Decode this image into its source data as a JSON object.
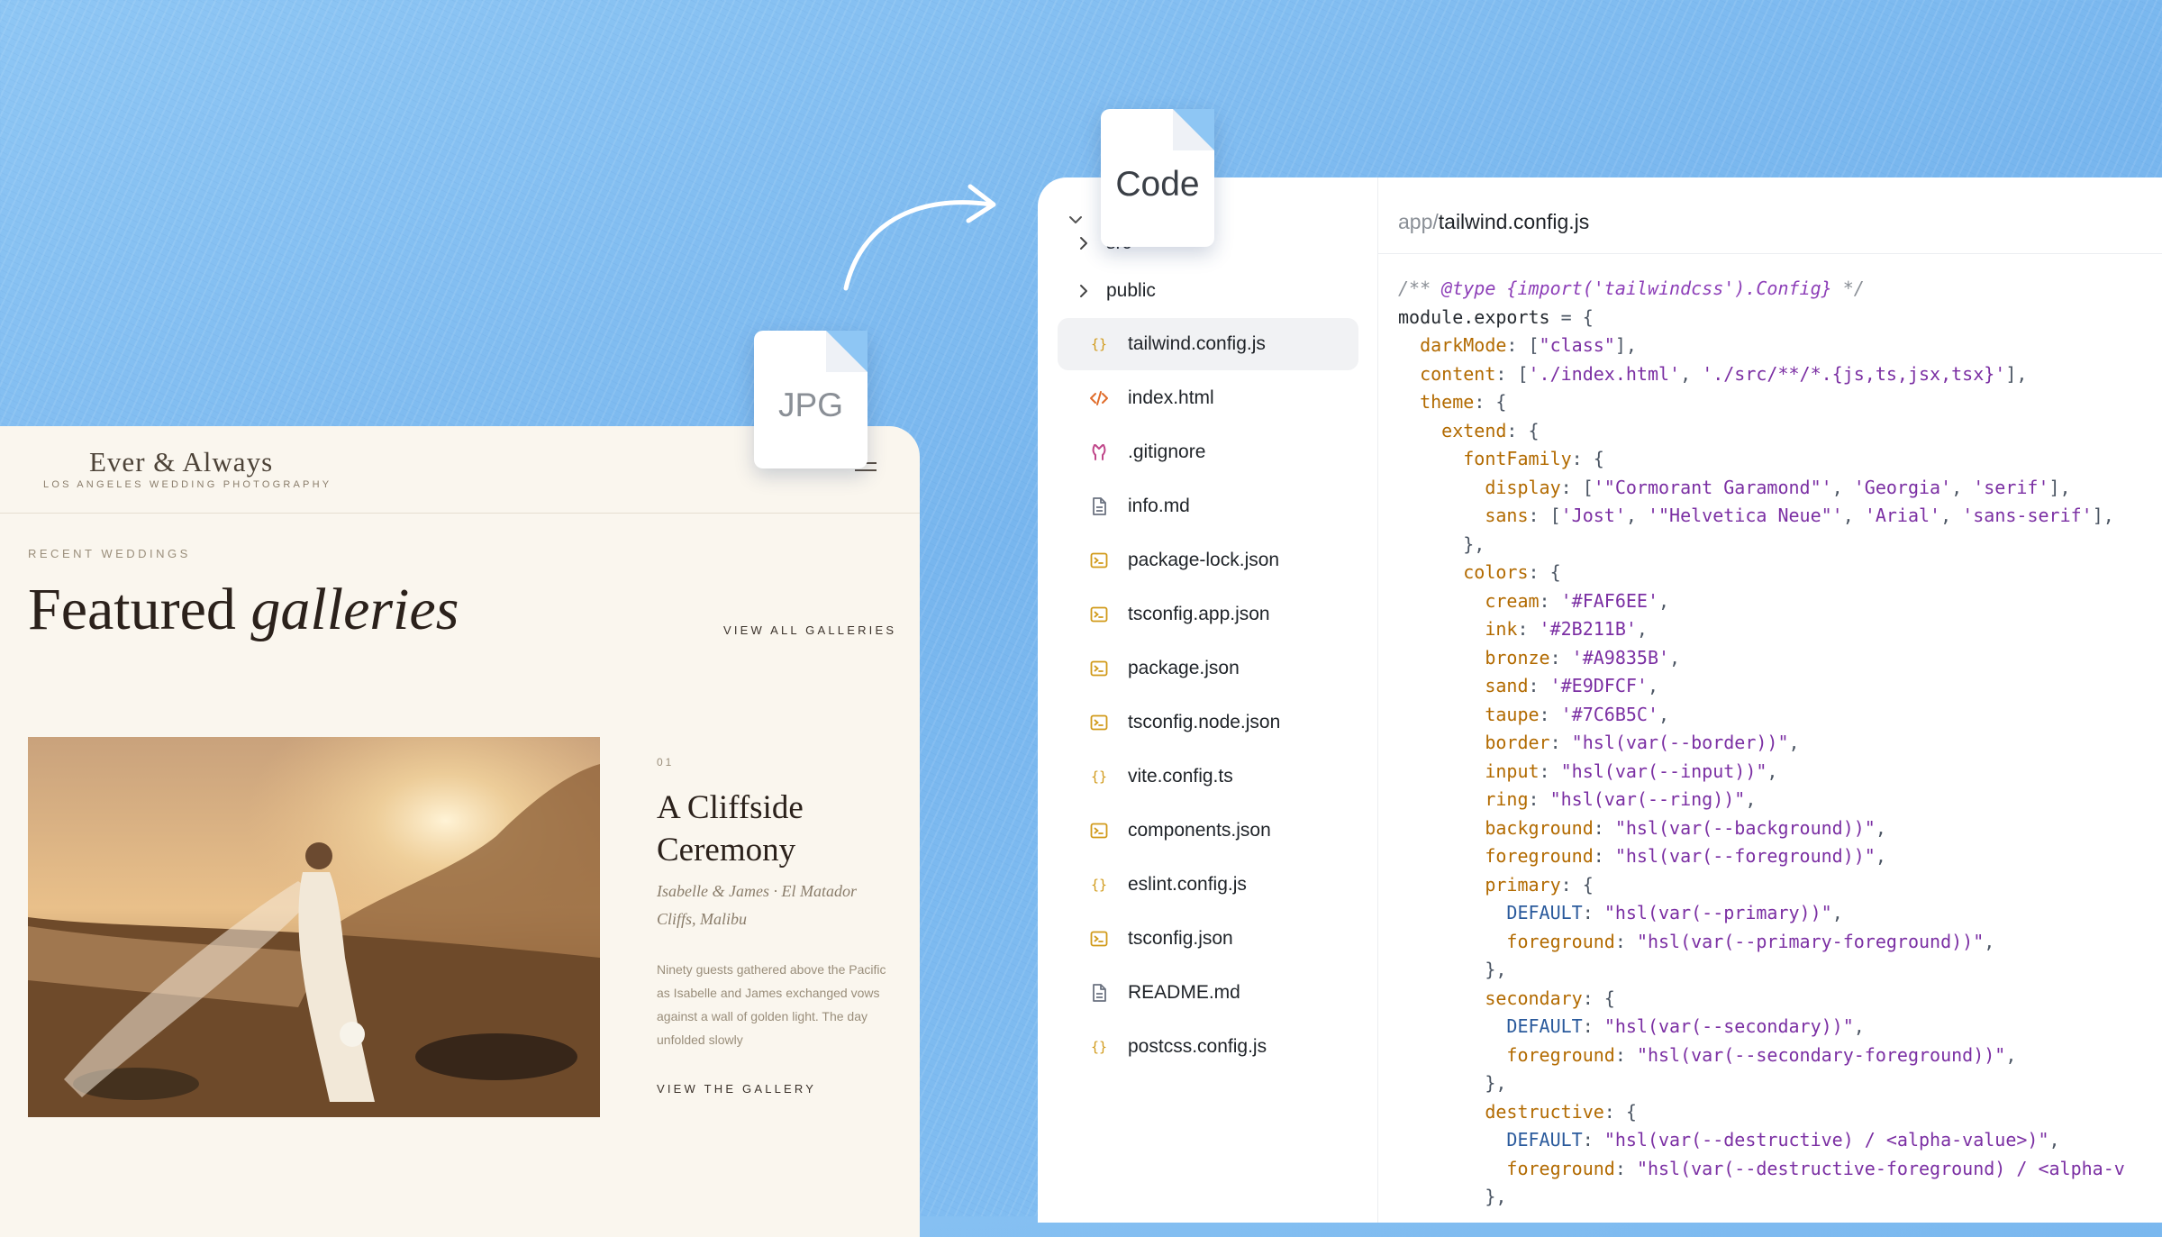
{
  "site": {
    "brand_name": "Ever & Always",
    "brand_tagline": "LOS ANGELES WEDDING PHOTOGRAPHY",
    "section_label": "RECENT WEDDINGS",
    "title_plain": "Featured ",
    "title_italic": "galleries",
    "view_all": "VIEW ALL GALLERIES",
    "feature": {
      "number": "01",
      "title": "A Cliffside Ceremony",
      "subtitle": "Isabelle & James · El Matador Cliffs, Malibu",
      "body": "Ninety guests gathered above the Pacific as Isabelle and James exchanged vows against a wall of golden light. The day unfolded slowly",
      "cta": "VIEW THE GALLERY"
    }
  },
  "badges": {
    "jpg": "JPG",
    "code": "Code"
  },
  "file_tree": {
    "items": [
      {
        "name": "src",
        "type": "folder",
        "icon": "chevron-right-icon"
      },
      {
        "name": "public",
        "type": "folder",
        "icon": "chevron-right-icon"
      },
      {
        "name": "tailwind.config.js",
        "type": "file",
        "icon": "braces-icon",
        "active": true
      },
      {
        "name": "index.html",
        "type": "file",
        "icon": "code-tag-icon"
      },
      {
        "name": ".gitignore",
        "type": "file",
        "icon": "git-icon"
      },
      {
        "name": "info.md",
        "type": "file",
        "icon": "document-icon"
      },
      {
        "name": "package-lock.json",
        "type": "file",
        "icon": "terminal-icon"
      },
      {
        "name": "tsconfig.app.json",
        "type": "file",
        "icon": "terminal-icon"
      },
      {
        "name": "package.json",
        "type": "file",
        "icon": "terminal-icon"
      },
      {
        "name": "tsconfig.node.json",
        "type": "file",
        "icon": "terminal-icon"
      },
      {
        "name": "vite.config.ts",
        "type": "file",
        "icon": "braces-icon"
      },
      {
        "name": "components.json",
        "type": "file",
        "icon": "terminal-icon"
      },
      {
        "name": "eslint.config.js",
        "type": "file",
        "icon": "braces-icon"
      },
      {
        "name": "tsconfig.json",
        "type": "file",
        "icon": "terminal-icon"
      },
      {
        "name": "README.md",
        "type": "file",
        "icon": "document-icon"
      },
      {
        "name": "postcss.config.js",
        "type": "file",
        "icon": "braces-icon"
      }
    ]
  },
  "editor": {
    "breadcrumb_dir": "app",
    "breadcrumb_sep": "/",
    "breadcrumb_file": "tailwind.config.js",
    "code_lines": [
      [
        [
          "c-com",
          "/** "
        ],
        [
          "c-doc",
          "@type {import('tailwindcss').Config}"
        ],
        [
          "c-com",
          " */"
        ]
      ],
      [
        [
          "",
          "module.exports "
        ],
        [
          "c-pun",
          "= {"
        ]
      ],
      [
        [
          "",
          "  "
        ],
        [
          "c-key",
          "darkMode"
        ],
        [
          "c-pun",
          ": ["
        ],
        [
          "c-str",
          "\"class\""
        ],
        [
          "c-pun",
          "],"
        ]
      ],
      [
        [
          "",
          "  "
        ],
        [
          "c-key",
          "content"
        ],
        [
          "c-pun",
          ": ["
        ],
        [
          "c-str",
          "'./index.html'"
        ],
        [
          "c-pun",
          ", "
        ],
        [
          "c-str",
          "'./src/**/*.{js,ts,jsx,tsx}'"
        ],
        [
          "c-pun",
          "],"
        ]
      ],
      [
        [
          "",
          "  "
        ],
        [
          "c-key",
          "theme"
        ],
        [
          "c-pun",
          ": {"
        ]
      ],
      [
        [
          "",
          "    "
        ],
        [
          "c-key",
          "extend"
        ],
        [
          "c-pun",
          ": {"
        ]
      ],
      [
        [
          "",
          "      "
        ],
        [
          "c-key",
          "fontFamily"
        ],
        [
          "c-pun",
          ": {"
        ]
      ],
      [
        [
          "",
          "        "
        ],
        [
          "c-key",
          "display"
        ],
        [
          "c-pun",
          ": ["
        ],
        [
          "c-str",
          "'\"Cormorant Garamond\"'"
        ],
        [
          "c-pun",
          ", "
        ],
        [
          "c-str",
          "'Georgia'"
        ],
        [
          "c-pun",
          ", "
        ],
        [
          "c-str",
          "'serif'"
        ],
        [
          "c-pun",
          "],"
        ]
      ],
      [
        [
          "",
          "        "
        ],
        [
          "c-key",
          "sans"
        ],
        [
          "c-pun",
          ": ["
        ],
        [
          "c-str",
          "'Jost'"
        ],
        [
          "c-pun",
          ", "
        ],
        [
          "c-str",
          "'\"Helvetica Neue\"'"
        ],
        [
          "c-pun",
          ", "
        ],
        [
          "c-str",
          "'Arial'"
        ],
        [
          "c-pun",
          ", "
        ],
        [
          "c-str",
          "'sans-serif'"
        ],
        [
          "c-pun",
          "],"
        ]
      ],
      [
        [
          "",
          "      "
        ],
        [
          "c-pun",
          "},"
        ]
      ],
      [
        [
          "",
          "      "
        ],
        [
          "c-key",
          "colors"
        ],
        [
          "c-pun",
          ": {"
        ]
      ],
      [
        [
          "",
          "        "
        ],
        [
          "c-key",
          "cream"
        ],
        [
          "c-pun",
          ": "
        ],
        [
          "c-str",
          "'#FAF6EE'"
        ],
        [
          "c-pun",
          ","
        ]
      ],
      [
        [
          "",
          "        "
        ],
        [
          "c-key",
          "ink"
        ],
        [
          "c-pun",
          ": "
        ],
        [
          "c-str",
          "'#2B211B'"
        ],
        [
          "c-pun",
          ","
        ]
      ],
      [
        [
          "",
          "        "
        ],
        [
          "c-key",
          "bronze"
        ],
        [
          "c-pun",
          ": "
        ],
        [
          "c-str",
          "'#A9835B'"
        ],
        [
          "c-pun",
          ","
        ]
      ],
      [
        [
          "",
          "        "
        ],
        [
          "c-key",
          "sand"
        ],
        [
          "c-pun",
          ": "
        ],
        [
          "c-str",
          "'#E9DFCF'"
        ],
        [
          "c-pun",
          ","
        ]
      ],
      [
        [
          "",
          "        "
        ],
        [
          "c-key",
          "taupe"
        ],
        [
          "c-pun",
          ": "
        ],
        [
          "c-str",
          "'#7C6B5C'"
        ],
        [
          "c-pun",
          ","
        ]
      ],
      [
        [
          "",
          "        "
        ],
        [
          "c-key",
          "border"
        ],
        [
          "c-pun",
          ": "
        ],
        [
          "c-str",
          "\"hsl(var(--border))\""
        ],
        [
          "c-pun",
          ","
        ]
      ],
      [
        [
          "",
          "        "
        ],
        [
          "c-key",
          "input"
        ],
        [
          "c-pun",
          ": "
        ],
        [
          "c-str",
          "\"hsl(var(--input))\""
        ],
        [
          "c-pun",
          ","
        ]
      ],
      [
        [
          "",
          "        "
        ],
        [
          "c-key",
          "ring"
        ],
        [
          "c-pun",
          ": "
        ],
        [
          "c-str",
          "\"hsl(var(--ring))\""
        ],
        [
          "c-pun",
          ","
        ]
      ],
      [
        [
          "",
          "        "
        ],
        [
          "c-key",
          "background"
        ],
        [
          "c-pun",
          ": "
        ],
        [
          "c-str",
          "\"hsl(var(--background))\""
        ],
        [
          "c-pun",
          ","
        ]
      ],
      [
        [
          "",
          "        "
        ],
        [
          "c-key",
          "foreground"
        ],
        [
          "c-pun",
          ": "
        ],
        [
          "c-str",
          "\"hsl(var(--foreground))\""
        ],
        [
          "c-pun",
          ","
        ]
      ],
      [
        [
          "",
          "        "
        ],
        [
          "c-key",
          "primary"
        ],
        [
          "c-pun",
          ": {"
        ]
      ],
      [
        [
          "",
          "          "
        ],
        [
          "c-prop",
          "DEFAULT"
        ],
        [
          "c-pun",
          ": "
        ],
        [
          "c-str",
          "\"hsl(var(--primary))\""
        ],
        [
          "c-pun",
          ","
        ]
      ],
      [
        [
          "",
          "          "
        ],
        [
          "c-key",
          "foreground"
        ],
        [
          "c-pun",
          ": "
        ],
        [
          "c-str",
          "\"hsl(var(--primary-foreground))\""
        ],
        [
          "c-pun",
          ","
        ]
      ],
      [
        [
          "",
          "        "
        ],
        [
          "c-pun",
          "},"
        ]
      ],
      [
        [
          "",
          "        "
        ],
        [
          "c-key",
          "secondary"
        ],
        [
          "c-pun",
          ": {"
        ]
      ],
      [
        [
          "",
          "          "
        ],
        [
          "c-prop",
          "DEFAULT"
        ],
        [
          "c-pun",
          ": "
        ],
        [
          "c-str",
          "\"hsl(var(--secondary))\""
        ],
        [
          "c-pun",
          ","
        ]
      ],
      [
        [
          "",
          "          "
        ],
        [
          "c-key",
          "foreground"
        ],
        [
          "c-pun",
          ": "
        ],
        [
          "c-str",
          "\"hsl(var(--secondary-foreground))\""
        ],
        [
          "c-pun",
          ","
        ]
      ],
      [
        [
          "",
          "        "
        ],
        [
          "c-pun",
          "},"
        ]
      ],
      [
        [
          "",
          "        "
        ],
        [
          "c-key",
          "destructive"
        ],
        [
          "c-pun",
          ": {"
        ]
      ],
      [
        [
          "",
          "          "
        ],
        [
          "c-prop",
          "DEFAULT"
        ],
        [
          "c-pun",
          ": "
        ],
        [
          "c-str",
          "\"hsl(var(--destructive) / <alpha-value>)\""
        ],
        [
          "c-pun",
          ","
        ]
      ],
      [
        [
          "",
          "          "
        ],
        [
          "c-key",
          "foreground"
        ],
        [
          "c-pun",
          ": "
        ],
        [
          "c-str",
          "\"hsl(var(--destructive-foreground) / <alpha-v"
        ]
      ],
      [
        [
          "",
          "        "
        ],
        [
          "c-pun",
          "},"
        ]
      ]
    ]
  }
}
